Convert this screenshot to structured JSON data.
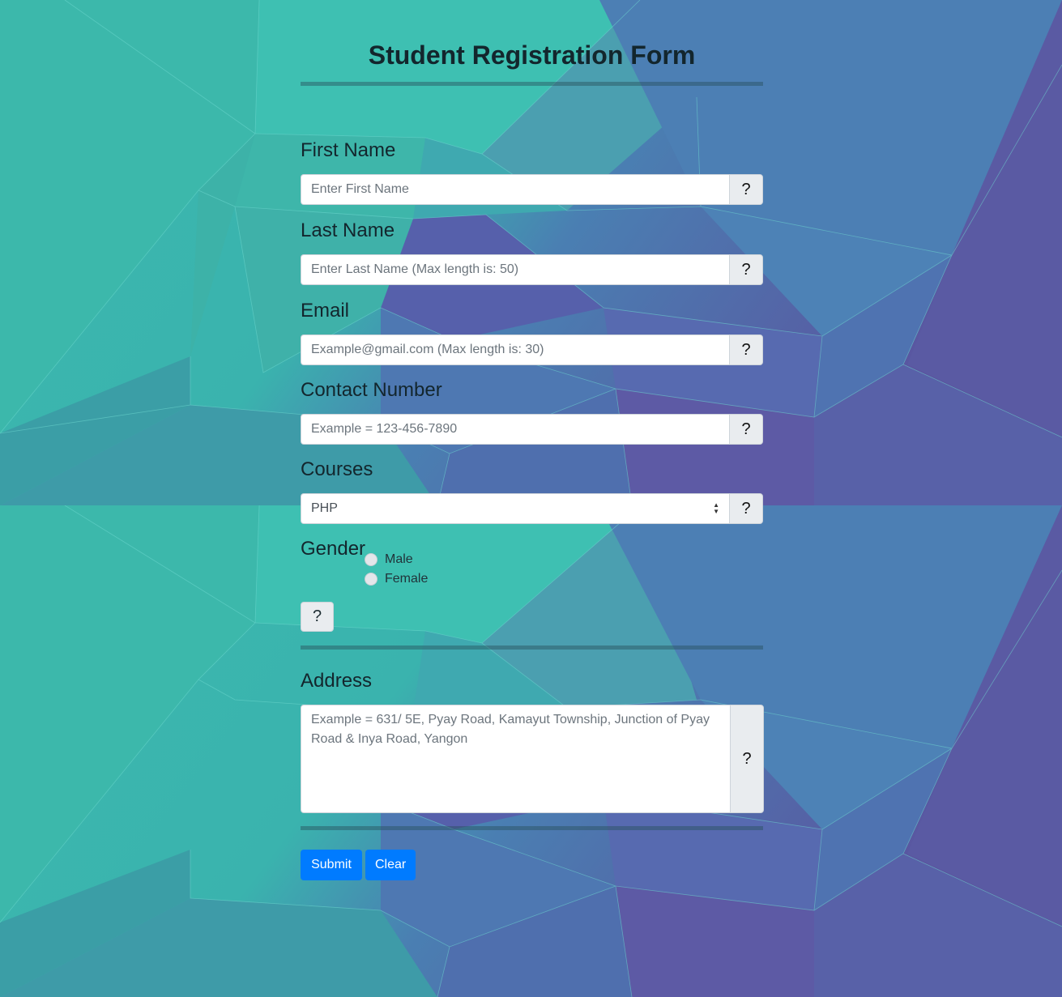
{
  "form": {
    "title": "Student Registration Form",
    "fields": {
      "first_name": {
        "label": "First Name",
        "placeholder": "Enter First Name",
        "help": "?"
      },
      "last_name": {
        "label": "Last Name",
        "placeholder": "Enter Last Name (Max length is: 50)",
        "help": "?"
      },
      "email": {
        "label": "Email",
        "placeholder": "Example@gmail.com (Max length is: 30)",
        "help": "?"
      },
      "contact": {
        "label": "Contact Number",
        "placeholder": "Example = 123-456-7890",
        "help": "?"
      },
      "courses": {
        "label": "Courses",
        "selected": "PHP",
        "help": "?"
      },
      "gender": {
        "label": "Gender",
        "options": [
          "Male",
          "Female"
        ],
        "help": "?"
      },
      "address": {
        "label": "Address",
        "placeholder": "Example = 631/ 5E, Pyay Road, Kamayut Township, Junction of Pyay Road & Inya Road, Yangon",
        "help": "?"
      }
    },
    "buttons": {
      "submit": "Submit",
      "clear": "Clear"
    }
  },
  "colors": {
    "accent": "#007bff",
    "help_bg": "#e9ecef",
    "bg_teal": "#3dbdb0",
    "bg_blue": "#4f79b0",
    "bg_purple": "#5a5aa0"
  },
  "icons": {
    "help": "question-mark-icon"
  }
}
